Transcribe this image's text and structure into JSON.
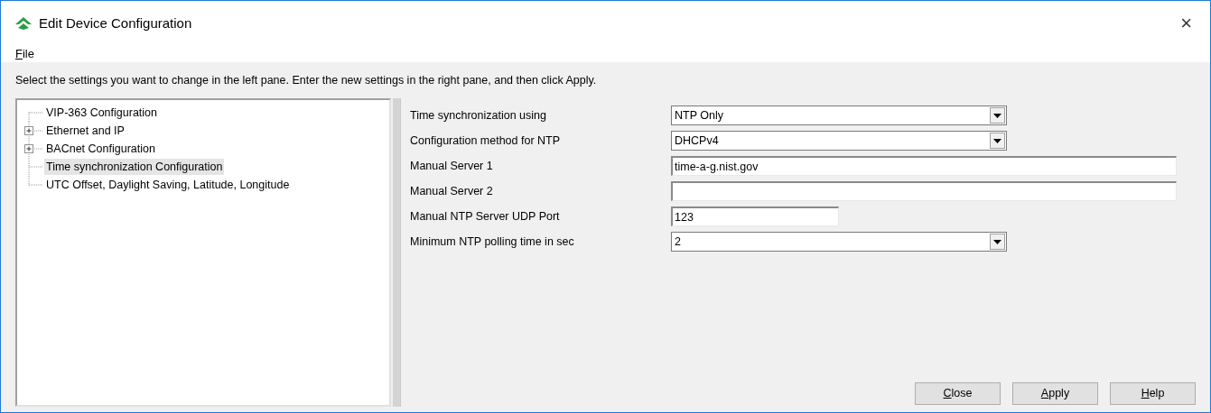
{
  "window": {
    "title": "Edit Device Configuration",
    "close": "×"
  },
  "menu": [
    {
      "label": "File"
    }
  ],
  "instructions": "Select the settings you want to change in the left pane. Enter the new settings in the right pane, and then click Apply.",
  "tree": [
    {
      "label": "VIP-363 Configuration",
      "kind": "leaf",
      "selected": false
    },
    {
      "label": "Ethernet and IP",
      "kind": "branch",
      "expanded": false,
      "selected": false
    },
    {
      "label": "BACnet Configuration",
      "kind": "branch",
      "expanded": false,
      "selected": false
    },
    {
      "label": "Time synchronization Configuration",
      "kind": "leaf",
      "selected": true
    },
    {
      "label": "UTC Offset, Daylight Saving, Latitude, Longitude",
      "kind": "leaf",
      "selected": false
    }
  ],
  "settings": [
    {
      "label": "Time synchronization using",
      "kind": "dropdown",
      "value": "NTP Only"
    },
    {
      "label": "Configuration method for NTP",
      "kind": "dropdown",
      "value": "DHCPv4"
    },
    {
      "label": "Manual Server 1",
      "kind": "text",
      "value": "time-a-g.nist.gov"
    },
    {
      "label": "Manual Server 2",
      "kind": "text"
    },
    {
      "label": "Manual NTP Server UDP Port",
      "kind": "number",
      "value": "123"
    },
    {
      "label": "Minimum NTP polling time in sec",
      "kind": "dropdown",
      "value": "2"
    }
  ],
  "buttons": [
    {
      "label": "Close"
    },
    {
      "label": "Apply"
    },
    {
      "label": "Help"
    }
  ]
}
